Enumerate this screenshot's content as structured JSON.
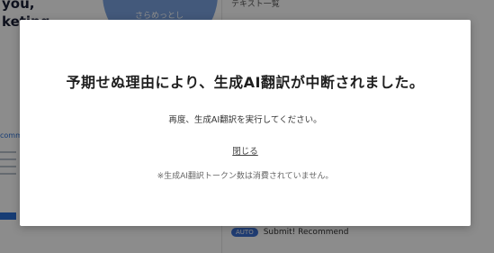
{
  "background": {
    "hero_line_1": "you,",
    "hero_line_2": "keting.",
    "circle_label": "さらめっとし",
    "right_title": "テキスト一覧",
    "section_label": "commend",
    "auto_badge": "AUTO",
    "submit_text": "Submit! Recommend"
  },
  "modal": {
    "title": "予期せぬ理由により、生成AI翻訳が中断されました。",
    "message": "再度、生成AI翻訳を実行してください。",
    "close_label": "閉じる",
    "note": "※生成AI翻訳トークン数は消費されていません。"
  },
  "colors": {
    "overlay": "rgba(0,0,0,0.45)",
    "accent": "#2a6fd6",
    "modal_bg": "#ffffff"
  }
}
